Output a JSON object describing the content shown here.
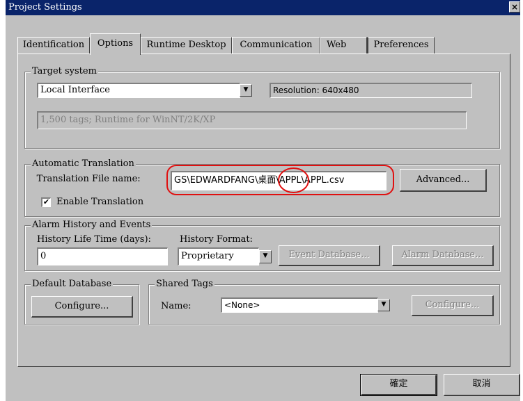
{
  "window": {
    "title": "Project Settings",
    "close": "×"
  },
  "tabs": [
    "Identification",
    "Options",
    "Runtime Desktop",
    "Communication",
    "Web",
    "Preferences"
  ],
  "target_system": {
    "legend": "Target system",
    "selected": "Local Interface",
    "resolution": "Resolution: 640x480",
    "info": "1,500 tags; Runtime for WinNT/2K/XP"
  },
  "automatic_translation": {
    "legend": "Automatic Translation",
    "file_label": "Translation File name:",
    "file_value": "GS\\EDWARDFANG\\桌面\\APPL\\APPL.csv",
    "advanced": "Advanced...",
    "enable_label": "Enable Translation",
    "enable_checked": "✔"
  },
  "alarm_history": {
    "legend": "Alarm History and Events",
    "life_label": "History Life Time (days):",
    "life_value": "0",
    "format_label": "History Format:",
    "format_value": "Proprietary",
    "event_db": "Event Database...",
    "alarm_db": "Alarm Database..."
  },
  "default_database": {
    "legend": "Default Database",
    "configure": "Configure..."
  },
  "shared_tags": {
    "legend": "Shared Tags",
    "name_label": "Name:",
    "name_value": "<None>",
    "configure": "Configure..."
  },
  "footer": {
    "ok": "確定",
    "cancel": "取消"
  },
  "colors": {
    "titlebar": "#0a246a",
    "dialog": "#c0c0c0",
    "highlight": "#e01010"
  }
}
